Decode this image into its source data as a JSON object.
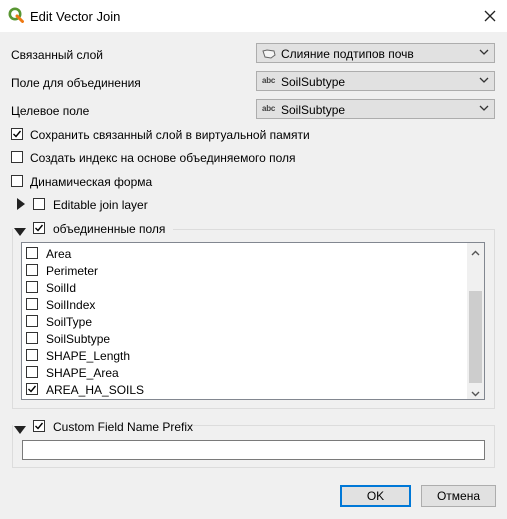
{
  "window": {
    "title": "Edit Vector Join"
  },
  "form": {
    "join_layer_label": "Связанный слой",
    "join_layer_value": "Слияние подтипов почв",
    "join_field_label": "Поле для объединения",
    "join_field_value": "SoilSubtype",
    "target_field_label": "Целевое поле",
    "target_field_value": "SoilSubtype",
    "cache_label": "Сохранить связанный слой в виртуальной памяти",
    "cache_checked": true,
    "index_label": "Создать индекс на основе объединяемого поля",
    "index_checked": false,
    "dynamic_form_label": "Динамическая форма",
    "dynamic_form_checked": false,
    "editable_label": "Editable join layer",
    "editable_checked": false
  },
  "joined_fields": {
    "label": "объединенные поля",
    "checked": true,
    "items": [
      {
        "label": "Area",
        "checked": false
      },
      {
        "label": "Perimeter",
        "checked": false
      },
      {
        "label": "SoilId",
        "checked": false
      },
      {
        "label": "SoilIndex",
        "checked": false
      },
      {
        "label": "SoilType",
        "checked": false
      },
      {
        "label": "SoilSubtype",
        "checked": false
      },
      {
        "label": "SHAPE_Length",
        "checked": false
      },
      {
        "label": "SHAPE_Area",
        "checked": false
      },
      {
        "label": "AREA_HA_SOILS",
        "checked": true
      }
    ]
  },
  "prefix": {
    "label": "Custom Field Name Prefix",
    "checked": true,
    "value": ""
  },
  "buttons": {
    "ok": "OK",
    "cancel": "Отмена"
  },
  "icons": {
    "app": "qgis-logo-icon",
    "close": "close-icon",
    "vector_layer": "polygon-layer-icon",
    "text_field": "abc-field-icon",
    "dropdown": "chevron-down-icon",
    "expand": "triangle-right-icon",
    "collapse": "triangle-down-icon"
  }
}
